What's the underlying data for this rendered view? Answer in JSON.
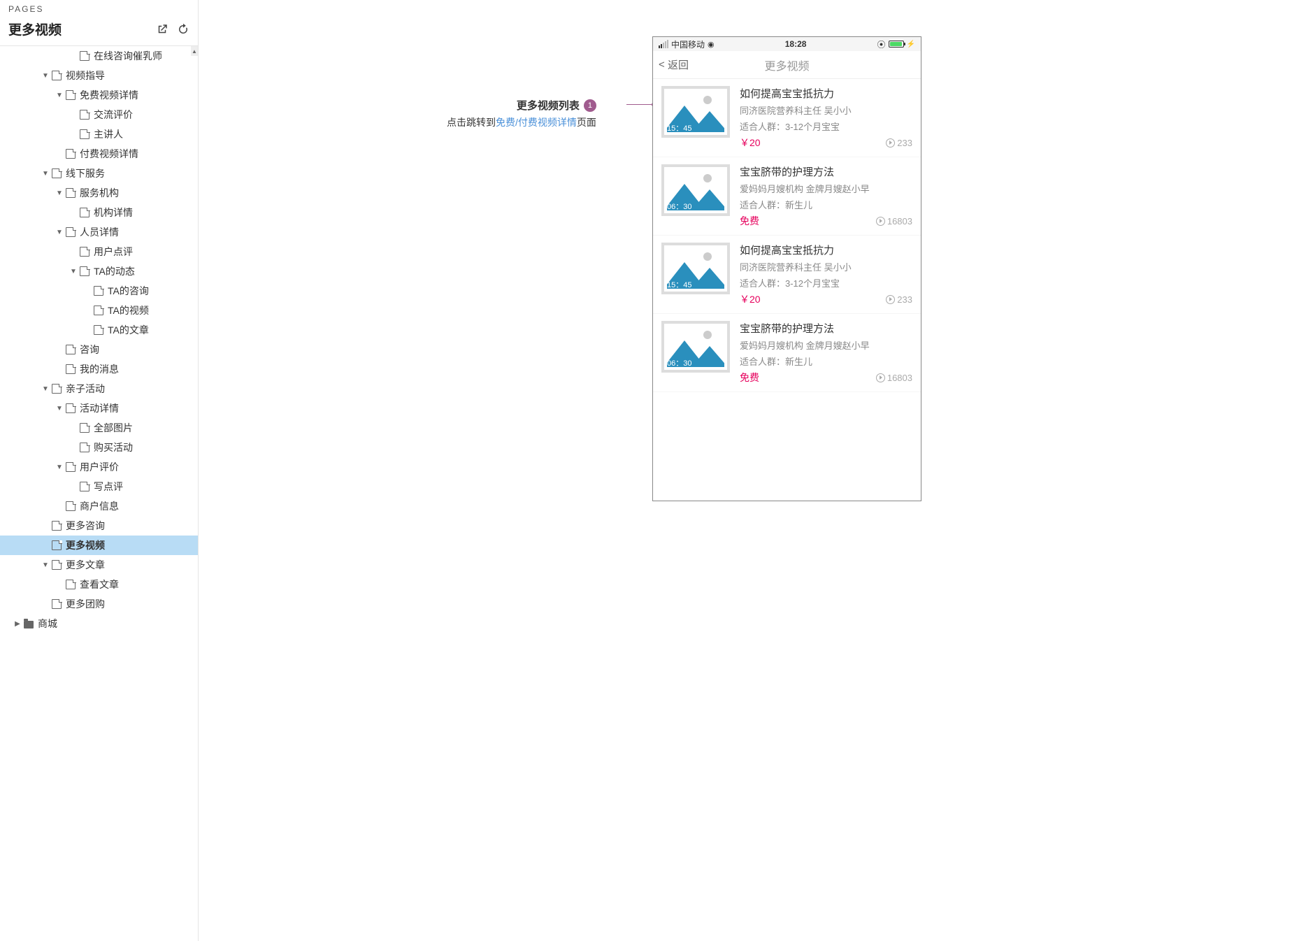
{
  "sidebar": {
    "header_label": "PAGES",
    "title": "更多视频",
    "tree": [
      {
        "indent": 5,
        "caret": "",
        "icon": "page",
        "label": "在线咨询催乳师"
      },
      {
        "indent": 3,
        "caret": "down",
        "icon": "page",
        "label": "视频指导"
      },
      {
        "indent": 4,
        "caret": "down",
        "icon": "page",
        "label": "免费视频详情"
      },
      {
        "indent": 5,
        "caret": "",
        "icon": "page",
        "label": "交流评价"
      },
      {
        "indent": 5,
        "caret": "",
        "icon": "page",
        "label": "主讲人"
      },
      {
        "indent": 4,
        "caret": "",
        "icon": "page",
        "label": "付费视频详情"
      },
      {
        "indent": 3,
        "caret": "down",
        "icon": "page",
        "label": "线下服务"
      },
      {
        "indent": 4,
        "caret": "down",
        "icon": "page",
        "label": "服务机构"
      },
      {
        "indent": 5,
        "caret": "",
        "icon": "page",
        "label": "机构详情"
      },
      {
        "indent": 4,
        "caret": "down",
        "icon": "page",
        "label": "人员详情"
      },
      {
        "indent": 5,
        "caret": "",
        "icon": "page",
        "label": "用户点评"
      },
      {
        "indent": 5,
        "caret": "down",
        "icon": "page",
        "label": "TA的动态"
      },
      {
        "indent": 6,
        "caret": "",
        "icon": "page",
        "label": "TA的咨询"
      },
      {
        "indent": 6,
        "caret": "",
        "icon": "page",
        "label": "TA的视频"
      },
      {
        "indent": 6,
        "caret": "",
        "icon": "page",
        "label": "TA的文章"
      },
      {
        "indent": 4,
        "caret": "",
        "icon": "page",
        "label": "咨询"
      },
      {
        "indent": 4,
        "caret": "",
        "icon": "page",
        "label": "我的消息"
      },
      {
        "indent": 3,
        "caret": "down",
        "icon": "page",
        "label": "亲子活动"
      },
      {
        "indent": 4,
        "caret": "down",
        "icon": "page",
        "label": "活动详情"
      },
      {
        "indent": 5,
        "caret": "",
        "icon": "page",
        "label": "全部图片"
      },
      {
        "indent": 5,
        "caret": "",
        "icon": "page",
        "label": "购买活动"
      },
      {
        "indent": 4,
        "caret": "down",
        "icon": "page",
        "label": "用户评价"
      },
      {
        "indent": 5,
        "caret": "",
        "icon": "page",
        "label": "写点评"
      },
      {
        "indent": 4,
        "caret": "",
        "icon": "page",
        "label": "商户信息"
      },
      {
        "indent": 3,
        "caret": "",
        "icon": "page",
        "label": "更多咨询"
      },
      {
        "indent": 3,
        "caret": "",
        "icon": "page",
        "label": "更多视频",
        "selected": true
      },
      {
        "indent": 3,
        "caret": "down",
        "icon": "page",
        "label": "更多文章"
      },
      {
        "indent": 4,
        "caret": "",
        "icon": "page",
        "label": "查看文章"
      },
      {
        "indent": 3,
        "caret": "",
        "icon": "page",
        "label": "更多团购"
      },
      {
        "indent": 1,
        "caret": "right",
        "icon": "folder",
        "label": "商城"
      }
    ]
  },
  "annotation": {
    "title": "更多视频列表",
    "badge": "1",
    "desc_pre": "点击跳转到",
    "desc_link": "免费/付费视频详情",
    "desc_post": "页面"
  },
  "phone": {
    "carrier": "中国移动",
    "time": "18:28",
    "back": "返回",
    "nav_title": "更多视频",
    "videos": [
      {
        "time": "15：45",
        "title": "如何提高宝宝抵抗力",
        "sub1": "同济医院营养科主任  吴小小",
        "sub2": "适合人群：3-12个月宝宝",
        "price": "￥20",
        "views": "233"
      },
      {
        "time": "06：30",
        "title": "宝宝脐带的护理方法",
        "sub1": "爱妈妈月嫂机构  金牌月嫂赵小早",
        "sub2": "适合人群：新生儿",
        "price": "免费",
        "views": "16803"
      },
      {
        "time": "15：45",
        "title": "如何提高宝宝抵抗力",
        "sub1": "同济医院营养科主任  吴小小",
        "sub2": "适合人群：3-12个月宝宝",
        "price": "￥20",
        "views": "233"
      },
      {
        "time": "06：30",
        "title": "宝宝脐带的护理方法",
        "sub1": "爱妈妈月嫂机构  金牌月嫂赵小早",
        "sub2": "适合人群：新生儿",
        "price": "免费",
        "views": "16803"
      }
    ]
  }
}
